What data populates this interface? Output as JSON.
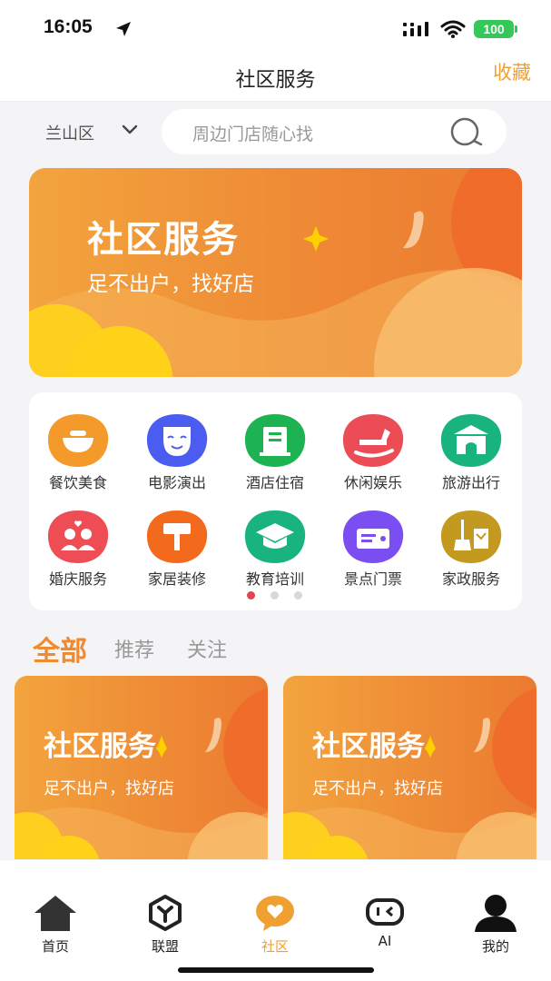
{
  "status_bar": {
    "time": "16:05",
    "battery": "100"
  },
  "nav": {
    "title": "社区服务",
    "favorite_label": "收藏"
  },
  "search": {
    "district": "兰山区",
    "placeholder": "周边门店随心找"
  },
  "banner": {
    "title": "社区服务",
    "subtitle": "足不出户，找好店"
  },
  "categories": [
    {
      "label": "餐饮美食",
      "icon": "bowl-icon",
      "color": "#f39a2a"
    },
    {
      "label": "电影演出",
      "icon": "mask-icon",
      "color": "#4b5cf0"
    },
    {
      "label": "酒店住宿",
      "icon": "hotel-icon",
      "color": "#1eb352"
    },
    {
      "label": "休闲娱乐",
      "icon": "rocking-horse-icon",
      "color": "#ec4c55"
    },
    {
      "label": "旅游出行",
      "icon": "gate-icon",
      "color": "#19b37d"
    },
    {
      "label": "婚庆服务",
      "icon": "couple-icon",
      "color": "#ef4d55"
    },
    {
      "label": "家居装修",
      "icon": "paint-roller-icon",
      "color": "#f36a1d"
    },
    {
      "label": "教育培训",
      "icon": "graduation-cap-icon",
      "color": "#18b37e"
    },
    {
      "label": "景点门票",
      "icon": "ticket-icon",
      "color": "#7a4ef0"
    },
    {
      "label": "家政服务",
      "icon": "broom-icon",
      "color": "#c39a1f"
    }
  ],
  "pager": {
    "count": 3,
    "active": 0
  },
  "feed_tabs": {
    "all": "全部",
    "recommend": "推荐",
    "follow": "关注",
    "active": "all"
  },
  "feed_cards": [
    {
      "title": "社区服务",
      "subtitle": "足不出户，找好店"
    },
    {
      "title": "社区服务",
      "subtitle": "足不出户，找好店"
    }
  ],
  "tab_bar": [
    {
      "label": "首页",
      "icon": "home-icon"
    },
    {
      "label": "联盟",
      "icon": "alliance-icon"
    },
    {
      "label": "社区",
      "icon": "community-icon",
      "active": true
    },
    {
      "label": "AI",
      "icon": "ai-icon"
    },
    {
      "label": "我的",
      "icon": "profile-icon"
    }
  ],
  "colors": {
    "accent": "#f0a030",
    "banner": "#ee8a36",
    "active_dot": "#e0474c"
  }
}
